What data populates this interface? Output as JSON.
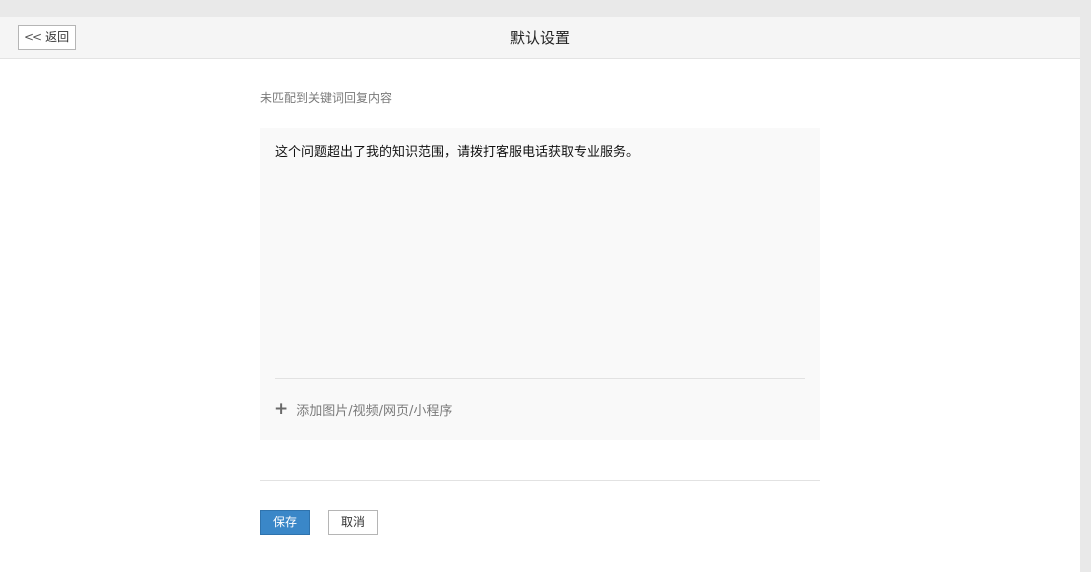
{
  "header": {
    "back_label": "返回",
    "title": "默认设置"
  },
  "form": {
    "section_label": "未匹配到关键词回复内容",
    "reply_text": "这个问题超出了我的知识范围，请拨打客服电话获取专业服务。",
    "add_media_label": "添加图片/视频/网页/小程序",
    "save_label": "保存",
    "cancel_label": "取消"
  },
  "icons": {
    "back": "double-chevron-left-icon",
    "add": "plus-icon"
  },
  "colors": {
    "primary_button": "#3a87c8",
    "editor_background": "#f9f9f9",
    "header_background": "#f5f5f5"
  }
}
